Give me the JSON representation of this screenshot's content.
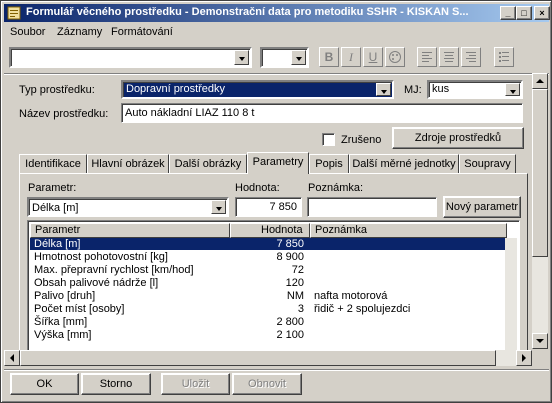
{
  "window": {
    "title": "Formulář věcného prostředku - Demonstrační data pro metodiku SSHR - KISKAN S...",
    "minimize": "_",
    "maximize": "□",
    "close": "×"
  },
  "menu": [
    "Soubor",
    "Záznamy",
    "Formátování"
  ],
  "toolbar": {
    "bold": "B",
    "italic": "I",
    "underline": "U"
  },
  "form": {
    "type_label": "Typ prostředku:",
    "type_value": "Dopravní prostředky",
    "mj_label": "MJ:",
    "mj_value": "kus",
    "name_label": "Název prostředku:",
    "name_value": "Auto nákladní LIAZ 110  8 t",
    "zruseno_label": "Zrušeno",
    "zdroje_button": "Zdroje prostředků"
  },
  "tabs": [
    "Identifikace",
    "Hlavní obrázek",
    "Další obrázky",
    "Parametry",
    "Popis",
    "Další měrné jednotky",
    "Soupravy"
  ],
  "parametry": {
    "param_label": "Parametr:",
    "param_value": "Délka [m]",
    "hodnota_label": "Hodnota:",
    "hodnota_value": "7 850",
    "poznamka_label": "Poznámka:",
    "poznamka_value": "",
    "new_button": "Nový parametr",
    "columns": [
      "Parametr",
      "Hodnota",
      "Poznámka"
    ],
    "rows": [
      {
        "parametr": "Délka [m]",
        "hodnota": "7 850",
        "poznamka": ""
      },
      {
        "parametr": "Hmotnost pohotovostní [kg]",
        "hodnota": "8 900",
        "poznamka": ""
      },
      {
        "parametr": "Max. přepravní rychlost [km/hod]",
        "hodnota": "72",
        "poznamka": ""
      },
      {
        "parametr": "Obsah palivové nádrže [l]",
        "hodnota": "120",
        "poznamka": ""
      },
      {
        "parametr": "Palivo [druh]",
        "hodnota": "NM",
        "poznamka": "nafta motorová"
      },
      {
        "parametr": "Počet míst [osoby]",
        "hodnota": "3",
        "poznamka": "řidič + 2 spolujezdci"
      },
      {
        "parametr": "Šířka [mm]",
        "hodnota": "2 800",
        "poznamka": ""
      },
      {
        "parametr": "Výška [mm]",
        "hodnota": "2 100",
        "poznamka": ""
      }
    ]
  },
  "footer": {
    "ok": "OK",
    "storno": "Storno",
    "ulozit": "Uložit",
    "obnovit": "Obnovit"
  },
  "colors": {
    "selection": "#0a246a",
    "title_start": "#0a246a",
    "title_end": "#a6caf0",
    "face": "#d4d0c8"
  }
}
